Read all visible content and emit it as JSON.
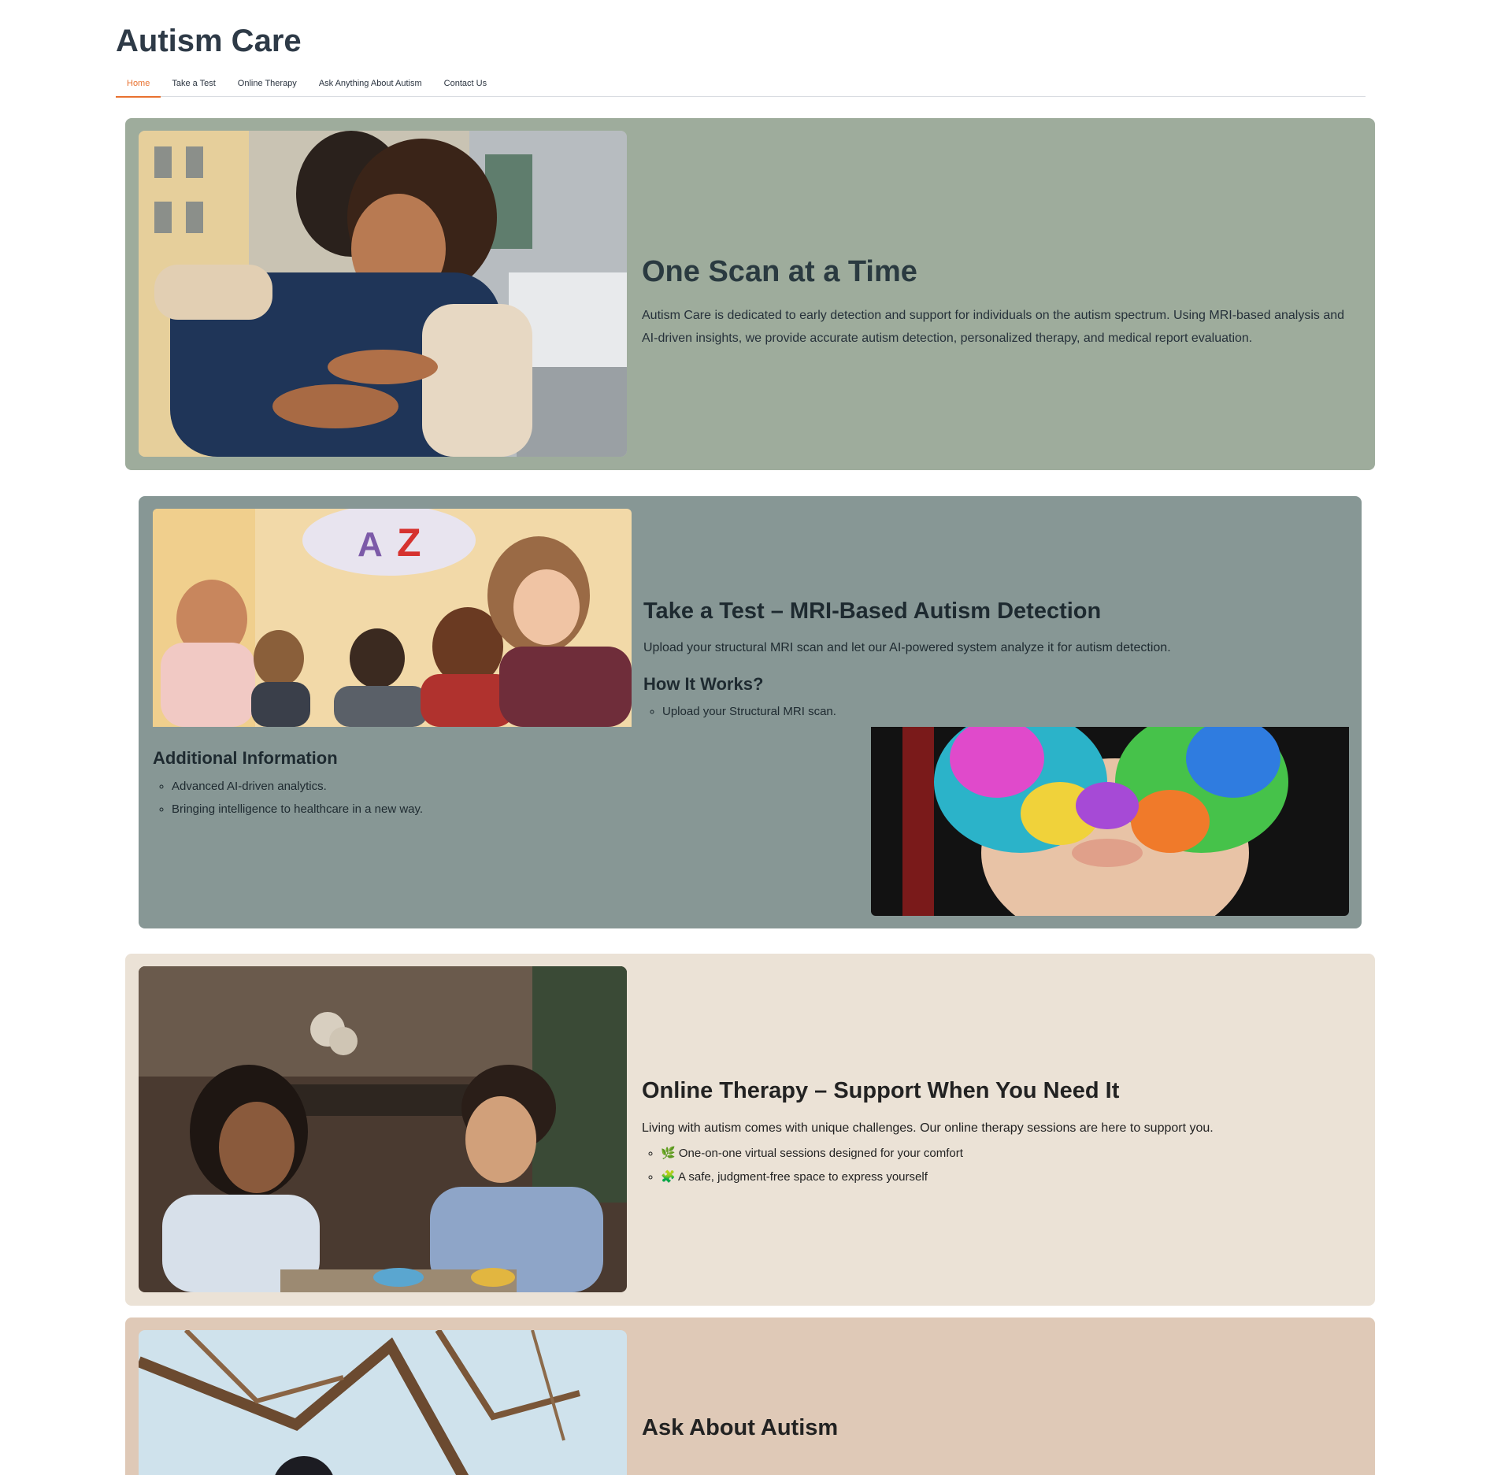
{
  "app": {
    "title": "Autism Care"
  },
  "tabs": [
    {
      "label": "Home"
    },
    {
      "label": "Take a Test"
    },
    {
      "label": "Online Therapy"
    },
    {
      "label": "Ask Anything About Autism"
    },
    {
      "label": "Contact Us"
    }
  ],
  "colors": {
    "accent": "#e8712f",
    "card1": "#9eac9c",
    "card2": "#879795",
    "card3": "#ebe2d6",
    "card4": "#dfc9b7"
  },
  "hero": {
    "title": "One Scan at a Time",
    "description": "Autism Care is dedicated to early detection and support for individuals on the autism spectrum. Using MRI-based analysis and AI-driven insights, we provide accurate autism detection, personalized therapy, and medical report evaluation."
  },
  "test": {
    "title": "Take a Test – MRI-Based Autism Detection",
    "description": "Upload your structural MRI scan and let our AI-powered system analyze it for autism detection.",
    "how_title": "How It Works?",
    "how_items": [
      "Upload your Structural MRI scan."
    ],
    "additional_title": "Additional Information",
    "additional_items": [
      "Advanced AI-driven analytics.",
      "Bringing intelligence to healthcare in a new way."
    ]
  },
  "therapy": {
    "title": "Online Therapy – Support When You Need It",
    "description": "Living with autism comes with unique challenges. Our online therapy sessions are here to support you.",
    "items": [
      {
        "icon": "🌿",
        "text": "One-on-one virtual sessions designed for your comfort"
      },
      {
        "icon": "🧩",
        "text": "A safe, judgment-free space to express yourself"
      }
    ]
  },
  "ask": {
    "title": "Ask About Autism"
  }
}
